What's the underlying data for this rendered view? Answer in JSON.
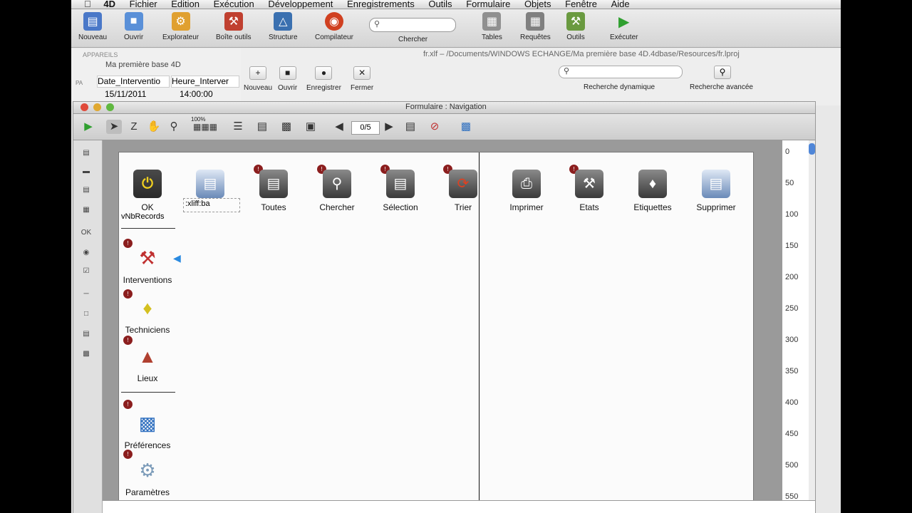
{
  "menubar": {
    "apple": "",
    "app": "4D",
    "items": [
      "Fichier",
      "Edition",
      "Exécution",
      "Développement",
      "Enregistrements",
      "Outils",
      "Formulaire",
      "Objets",
      "Fenêtre",
      "Aide"
    ]
  },
  "toolbar": {
    "nouveau": "Nouveau",
    "ouvrir": "Ouvrir",
    "explorateur": "Explorateur",
    "boite_outils": "Boîte outils",
    "structure": "Structure",
    "compilateur": "Compilateur",
    "chercher": "Chercher",
    "tables": "Tables",
    "requetes": "Requêtes",
    "outils": "Outils",
    "executer": "Exécuter"
  },
  "bg_window": {
    "header": "APPAREILS",
    "title": "Ma première base 4D",
    "pa": "PA",
    "col1": "Date_Interventio",
    "col2": "Heure_Interver",
    "val1": "15/11/2011",
    "val2": "14:00:00"
  },
  "xliff_window": {
    "path": "fr.xlf – /Documents/WINDOWS ECHANGE/Ma première base 4D.4dbase/Resources/fr.lproj",
    "buttons": {
      "nouveau": "Nouveau",
      "ouvrir": "Ouvrir",
      "enregistrer": "Enregistrer",
      "fermer": "Fermer"
    },
    "recherche_dynamique": "Recherche dynamique",
    "recherche_avancee": "Recherche avancée"
  },
  "form_window": {
    "title": "Formulaire : Navigation",
    "zoom": "100%",
    "pager": "0/5"
  },
  "nav_buttons": [
    "OK",
    "Toutes",
    "Chercher",
    "Sélection",
    "Trier",
    "Imprimer",
    "Etats",
    "Etiquettes",
    "Supprimer"
  ],
  "xliff_label": ":xliff:ba",
  "vnb": "vNbRecords",
  "side_items": [
    "Interventions",
    "Techniciens",
    "Lieux",
    "Préférences",
    "Paramètres"
  ],
  "ruler": [
    "0",
    "50",
    "100",
    "150",
    "200",
    "250",
    "300",
    "350",
    "400",
    "450",
    "500",
    "550"
  ]
}
